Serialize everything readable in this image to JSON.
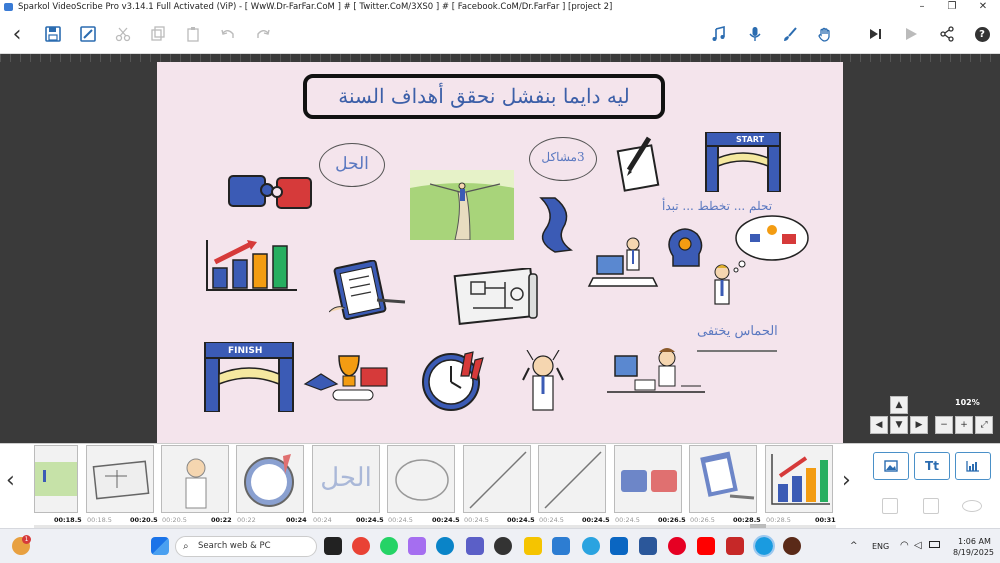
{
  "window": {
    "title": "Sparkol VideoScribe Pro v3.14.1 Full Activated (ViP) - [ WwW.Dr-FarFar.CoM ] # [ Twitter.CoM/3XS0 ] # [ Facebook.CoM/Dr.FarFar ] [project 2]",
    "minimize": "–",
    "maximize": "❐",
    "close": "✕"
  },
  "toolbar": {
    "back": "‹",
    "help": "?"
  },
  "stage": {
    "title": "ليه دايما بنفشل نحقق أهداف السنة",
    "label_solution": "الحل",
    "label_problems": "3مشاكل",
    "text_dream": "تحلم ... تخطط ... تبدأ",
    "text_enthusiasm": "الحماس يختفى",
    "start_sign": "START",
    "finish_sign": "FINISH"
  },
  "zoom": {
    "level": "102%"
  },
  "filmstrip": {
    "thumbnails": [
      {
        "name": "thumb-road",
        "start": "",
        "time": "00:18.5"
      },
      {
        "name": "thumb-plan",
        "start": "00:18.5",
        "time": "00:20.5"
      },
      {
        "name": "thumb-panic",
        "start": "00:20.5",
        "time": "00:22"
      },
      {
        "name": "thumb-clock",
        "start": "00:22",
        "time": "00:24"
      },
      {
        "name": "thumb-solution",
        "start": "00:24",
        "time": "00:24.5",
        "text": "الحل"
      },
      {
        "name": "thumb-circle",
        "start": "00:24.5",
        "time": "00:24.5"
      },
      {
        "name": "thumb-line-1",
        "start": "00:24.5",
        "time": "00:24.5"
      },
      {
        "name": "thumb-line-2",
        "start": "00:24.5",
        "time": "00:24.5"
      },
      {
        "name": "thumb-puzzle",
        "start": "00:24.5",
        "time": "00:26.5"
      },
      {
        "name": "thumb-clipboard",
        "start": "00:26.5",
        "time": "00:28.5"
      },
      {
        "name": "thumb-chart",
        "start": "00:28.5",
        "time": "00:31"
      }
    ],
    "text_button": "Tt"
  },
  "taskbar": {
    "search_placeholder": "Search web & PC",
    "language": "ENG",
    "time": "1:06 AM",
    "date": "8/19/2025",
    "notification_count": "1"
  }
}
